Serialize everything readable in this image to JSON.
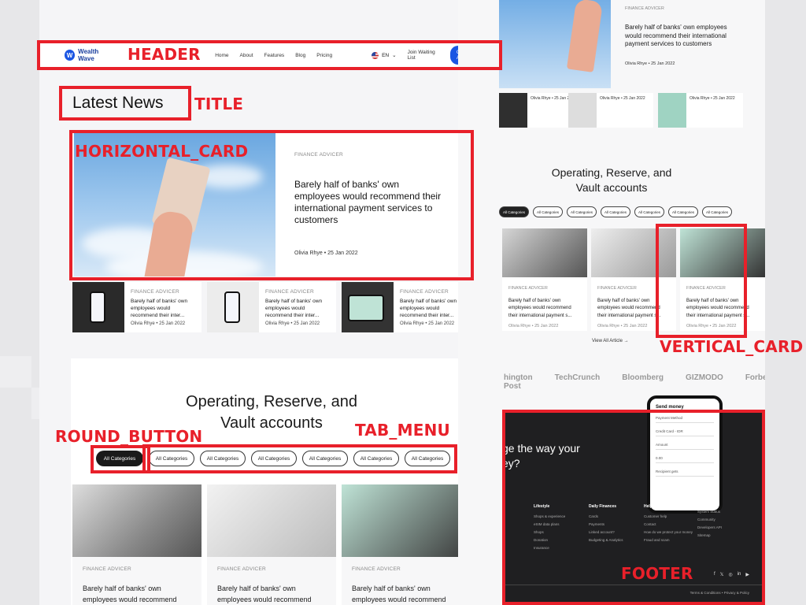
{
  "annotations": {
    "header": "HEADER",
    "title": "TITLE",
    "horizontal_card": "HORIZONTAL_CARD",
    "vertical_card": "VERTICAL_CARD",
    "round_button": "ROUND_BUTTON",
    "tab_menu": "TAB_MENU",
    "footer": "FOOTER"
  },
  "header": {
    "logo_mark": "W",
    "logo_text": "Wealth Wave",
    "nav": [
      "Home",
      "About",
      "Features",
      "Blog",
      "Pricing"
    ],
    "lang": "EN",
    "waitlist": "Join Waiting List",
    "cta": "Get App"
  },
  "title": "Latest News",
  "featured": {
    "category": "FINANCE ADVICER",
    "title": "Barely half of banks' own employees would recommend their international payment services to customers",
    "meta": "Olivia Rhye • 25 Jan 2022"
  },
  "small_cards": [
    {
      "category": "FINANCE ADVICER",
      "title": "Barely half of banks' own employees would recommend their inter...",
      "meta": "Olivia Rhye • 25 Jan 2022"
    },
    {
      "category": "FINANCE ADVICER",
      "title": "Barely half of banks' own employees would recommend their inter...",
      "meta": "Olivia Rhye • 25 Jan 2022"
    },
    {
      "category": "FINANCE ADVICER",
      "title": "Barely half of banks' own employees would recommend their inter...",
      "meta": "Olivia Rhye • 25 Jan 2022"
    }
  ],
  "section": {
    "title_line1": "Operating, Reserve, and",
    "title_line2": "Vault accounts",
    "tabs": [
      "All Categories",
      "All Categories",
      "All Categories",
      "All Categories",
      "All Categories",
      "All Categories",
      "All Categories"
    ]
  },
  "vertical_cards": [
    {
      "category": "FINANCE ADVICER",
      "title": "Barely half of banks' own employees would recommend"
    },
    {
      "category": "FINANCE ADVICER",
      "title": "Barely half of banks' own employees would recommend"
    },
    {
      "category": "FINANCE ADVICER",
      "title": "Barely half of banks' own employees would recommend"
    }
  ],
  "right": {
    "featured": {
      "category": "FINANCE ADVICER",
      "title": "Barely half of banks' own employees would recommend their international payment services to customers",
      "meta": "Olivia Rhye • 25 Jan 2022"
    },
    "small_meta": "Olivia Rhye • 25 Jan 2022",
    "section_title_line1": "Operating, Reserve, and",
    "section_title_line2": "Vault accounts",
    "tab_label": "All Categories",
    "vcards": [
      {
        "category": "FINANCE ADVICER",
        "title": "Barely half of banks' own employees would recommend their international payment s...",
        "meta": "Olivia Rhye • 25 Jan 2022"
      },
      {
        "category": "FINANCE ADVICER",
        "title": "Barely half of banks' own employees would recommend their international payment s...",
        "meta": "Olivia Rhye • 25 Jan 2022"
      },
      {
        "category": "FINANCE ADVICER",
        "title": "Barely half of banks' own employees would recommend their international payment s...",
        "meta": "Olivia Rhye • 25 Jan 2022"
      }
    ],
    "view_all": "View All Article →",
    "brands": [
      "hington Post",
      "TechCrunch",
      "Bloomberg",
      "GIZMODO",
      "Forbes"
    ],
    "footer": {
      "hero_line1": "ge the way your",
      "hero_line2": "ey?",
      "phone_title": "Send money",
      "phone_rows": [
        "Payment Method",
        "Credit Card - IDR",
        "Amount",
        "0.00",
        "Recipient gets"
      ],
      "cols": [
        {
          "title": "Lifestyle",
          "items": [
            "Shops & experience",
            "eSIM data plans",
            "Shops",
            "Donation",
            "Insurance"
          ]
        },
        {
          "title": "Daily Finances",
          "items": [
            "Cards",
            "Payments",
            "Linked account?",
            "Budgeting & Analytics"
          ]
        },
        {
          "title": "Help & Security",
          "items": [
            "Customer help",
            "Contact",
            "How do we protect your money",
            "Fraud and scam"
          ]
        },
        {
          "title": "",
          "items": [
            "System Status",
            "Community",
            "Developers API",
            "Sitemap"
          ]
        }
      ],
      "legal": "Terms & Conditions  •  Privacy & Policy",
      "social": [
        "f",
        "𝕏",
        "◎",
        "in",
        "▶"
      ]
    }
  }
}
